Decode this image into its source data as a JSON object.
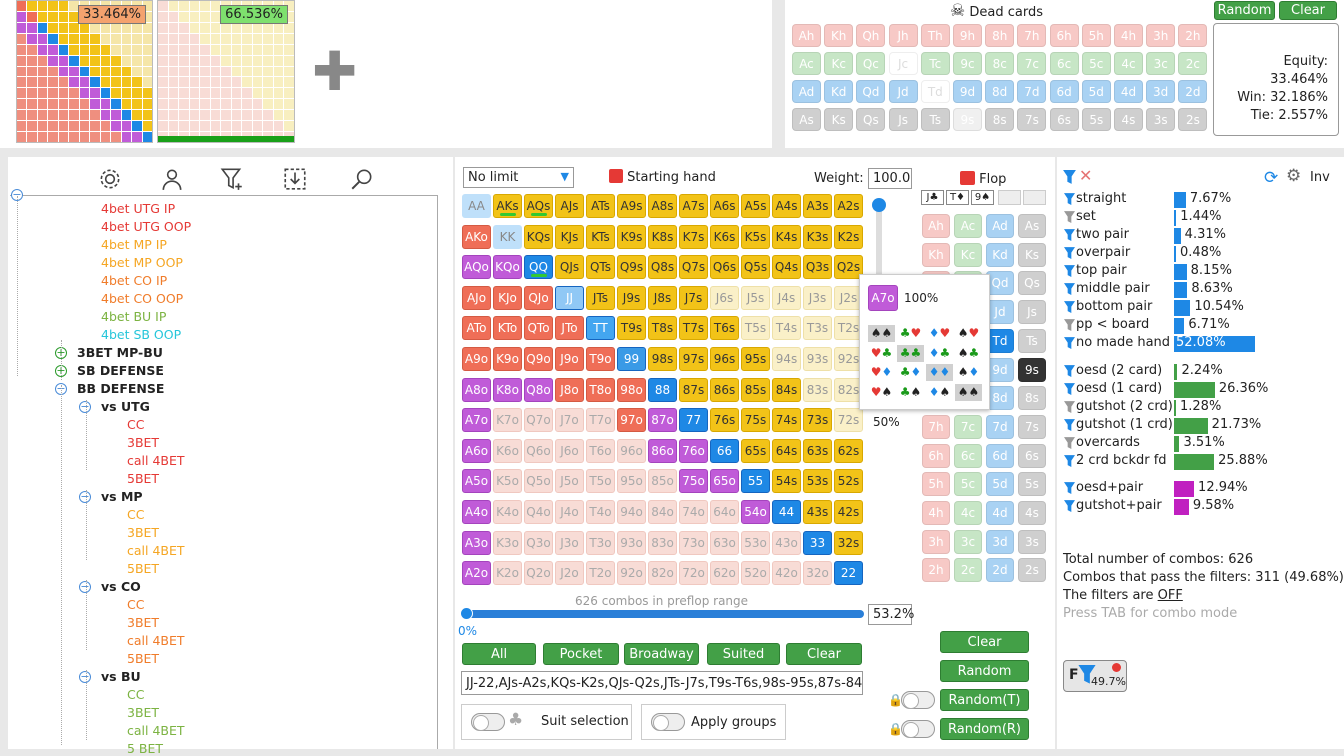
{
  "thumbs": {
    "left_equity": "33.464%",
    "right_equity": "66.536%"
  },
  "dead_cards": {
    "title": "Dead cards",
    "random_label": "Random",
    "clear_label": "Clear",
    "rows": [
      [
        "Ah",
        "Kh",
        "Qh",
        "Jh",
        "Th",
        "9h",
        "8h",
        "7h",
        "6h",
        "5h",
        "4h",
        "3h",
        "2h"
      ],
      [
        "Ac",
        "Kc",
        "Qc",
        "Jc",
        "Tc",
        "9c",
        "8c",
        "7c",
        "6c",
        "5c",
        "4c",
        "3c",
        "2c"
      ],
      [
        "Ad",
        "Kd",
        "Qd",
        "Jd",
        "Td",
        "9d",
        "8d",
        "7d",
        "6d",
        "5d",
        "4d",
        "3d",
        "2d"
      ],
      [
        "As",
        "Ks",
        "Qs",
        "Js",
        "Ts",
        "9s",
        "8s",
        "7s",
        "6s",
        "5s",
        "4s",
        "3s",
        "2s"
      ]
    ],
    "equity": "Equity: 33.464%",
    "win": "Win: 32.186%",
    "tie": "Tie: 2.557%"
  },
  "tree": {
    "items": [
      {
        "label": "4bet UTG IP",
        "color": "#e53935"
      },
      {
        "label": "4bet UTG OOP",
        "color": "#e53935"
      },
      {
        "label": "4bet MP IP",
        "color": "#f5a623"
      },
      {
        "label": "4bet MP OOP",
        "color": "#f5a623"
      },
      {
        "label": "4bet CO IP",
        "color": "#f07c2a"
      },
      {
        "label": "4bet CO OOP",
        "color": "#f07c2a"
      },
      {
        "label": "4bet BU IP",
        "color": "#7cb342"
      },
      {
        "label": "4bet SB OOP",
        "color": "#26c6da"
      },
      {
        "label": "3BET MP-BU",
        "color": "#222"
      },
      {
        "label": "SB DEFENSE",
        "color": "#222"
      },
      {
        "label": "BB DEFENSE",
        "color": "#222"
      },
      {
        "label": "vs UTG",
        "color": "#222"
      },
      {
        "label": "CC",
        "color": "#e53935"
      },
      {
        "label": "3BET",
        "color": "#e53935"
      },
      {
        "label": "call 4BET",
        "color": "#e53935"
      },
      {
        "label": "5BET",
        "color": "#e53935"
      },
      {
        "label": "vs MP",
        "color": "#222"
      },
      {
        "label": "CC",
        "color": "#f5a623"
      },
      {
        "label": "3BET",
        "color": "#f5a623"
      },
      {
        "label": "call 4BET",
        "color": "#f5a623"
      },
      {
        "label": "5BET",
        "color": "#f5a623"
      },
      {
        "label": "vs CO",
        "color": "#222"
      },
      {
        "label": "CC",
        "color": "#f07c2a"
      },
      {
        "label": "3BET",
        "color": "#f07c2a"
      },
      {
        "label": "call 4BET",
        "color": "#f07c2a"
      },
      {
        "label": "5BET",
        "color": "#f07c2a"
      },
      {
        "label": "vs BU",
        "color": "#222"
      },
      {
        "label": "CC",
        "color": "#7cb342"
      },
      {
        "label": "3BET",
        "color": "#7cb342"
      },
      {
        "label": "call 4BET",
        "color": "#7cb342"
      },
      {
        "label": "5 BET",
        "color": "#7cb342"
      }
    ]
  },
  "range": {
    "mode": "No limit",
    "starting_hand": "Starting hand",
    "weight_label": "Weight:",
    "weight_value": "100.00",
    "hands": [
      [
        "AA",
        "AKs",
        "AQs",
        "AJs",
        "ATs",
        "A9s",
        "A8s",
        "A7s",
        "A6s",
        "A5s",
        "A4s",
        "A3s",
        "A2s"
      ],
      [
        "AKo",
        "KK",
        "KQs",
        "KJs",
        "KTs",
        "K9s",
        "K8s",
        "K7s",
        "K6s",
        "K5s",
        "K4s",
        "K3s",
        "K2s"
      ],
      [
        "AQo",
        "KQo",
        "QQ",
        "QJs",
        "QTs",
        "Q9s",
        "Q8s",
        "Q7s",
        "Q6s",
        "Q5s",
        "Q4s",
        "Q3s",
        "Q2s"
      ],
      [
        "AJo",
        "KJo",
        "QJo",
        "JJ",
        "JTs",
        "J9s",
        "J8s",
        "J7s",
        "J6s",
        "J5s",
        "J4s",
        "J3s",
        "J2s"
      ],
      [
        "ATo",
        "KTo",
        "QTo",
        "JTo",
        "TT",
        "T9s",
        "T8s",
        "T7s",
        "T6s",
        "T5s",
        "T4s",
        "T3s",
        "T2s"
      ],
      [
        "A9o",
        "K9o",
        "Q9o",
        "J9o",
        "T9o",
        "99",
        "98s",
        "97s",
        "96s",
        "95s",
        "94s",
        "93s",
        "92s"
      ],
      [
        "A8o",
        "K8o",
        "Q8o",
        "J8o",
        "T8o",
        "98o",
        "88",
        "87s",
        "86s",
        "85s",
        "84s",
        "83s",
        "82s"
      ],
      [
        "A7o",
        "K7o",
        "Q7o",
        "J7o",
        "T7o",
        "97o",
        "87o",
        "77",
        "76s",
        "75s",
        "74s",
        "73s",
        "72s"
      ],
      [
        "A6o",
        "K6o",
        "Q6o",
        "J6o",
        "T6o",
        "96o",
        "86o",
        "76o",
        "66",
        "65s",
        "64s",
        "63s",
        "62s"
      ],
      [
        "A5o",
        "K5o",
        "Q5o",
        "J5o",
        "T5o",
        "95o",
        "85o",
        "75o",
        "65o",
        "55",
        "54s",
        "53s",
        "52s"
      ],
      [
        "A4o",
        "K4o",
        "Q4o",
        "J4o",
        "T4o",
        "94o",
        "84o",
        "74o",
        "64o",
        "54o",
        "44",
        "43s",
        "42s"
      ],
      [
        "A3o",
        "K3o",
        "Q3o",
        "J3o",
        "T3o",
        "93o",
        "83o",
        "73o",
        "63o",
        "53o",
        "43o",
        "33",
        "32s"
      ],
      [
        "A2o",
        "K2o",
        "Q2o",
        "J2o",
        "T2o",
        "92o",
        "82o",
        "72o",
        "62o",
        "52o",
        "42o",
        "32o",
        "22"
      ]
    ],
    "combos_text": "626 combos in preflop range",
    "slider_min": "0%",
    "pct_value": "53.2%",
    "buttons": [
      "All",
      "Pocket",
      "Broadway",
      "Suited",
      "Clear"
    ],
    "range_text": "JJ-22,AJs-A2s,KQs-K2s,QJs-Q2s,JTs-J7s,T9s-T6s,98s-95s,87s-84s,76",
    "suit_selection": "Suit selection",
    "apply_groups": "Apply groups",
    "popup_hand": "A7o",
    "popup_pct": "100%",
    "popup_pct2": "50%"
  },
  "flop": {
    "title": "Flop",
    "board": [
      "J♣",
      "T♦",
      "9♠"
    ],
    "rows": [
      [
        "Ah",
        "Ac",
        "Ad",
        "As"
      ],
      [
        "Kh",
        "Kc",
        "Kd",
        "Ks"
      ],
      [
        "Qh",
        "Qc",
        "Qd",
        "Qs"
      ],
      [
        "Jh",
        "Jc",
        "Jd",
        "Js"
      ],
      [
        "Th",
        "Tc",
        "Td",
        "Ts"
      ],
      [
        "9h",
        "9c",
        "9d",
        "9s"
      ],
      [
        "8h",
        "8c",
        "8d",
        "8s"
      ],
      [
        "7h",
        "7c",
        "7d",
        "7s"
      ],
      [
        "6h",
        "6c",
        "6d",
        "6s"
      ],
      [
        "5h",
        "5c",
        "5d",
        "5s"
      ],
      [
        "4h",
        "4c",
        "4d",
        "4s"
      ],
      [
        "3h",
        "3c",
        "3d",
        "3s"
      ],
      [
        "2h",
        "2c",
        "2d",
        "2s"
      ]
    ],
    "buttons": [
      "Clear",
      "Random",
      "Random(T)",
      "Random(R)"
    ]
  },
  "stats": {
    "inv_label": "Inv",
    "made": [
      {
        "label": "straight",
        "value": "7.67%",
        "pct": 7.67,
        "color": "#1e88e5"
      },
      {
        "label": "set",
        "value": "1.44%",
        "pct": 1.44,
        "color": "#1e88e5"
      },
      {
        "label": "two pair",
        "value": "4.31%",
        "pct": 4.31,
        "color": "#1e88e5"
      },
      {
        "label": "overpair",
        "value": "0.48%",
        "pct": 0.48,
        "color": "#1e88e5"
      },
      {
        "label": "top pair",
        "value": "8.15%",
        "pct": 8.15,
        "color": "#1e88e5"
      },
      {
        "label": "middle pair",
        "value": "8.63%",
        "pct": 8.63,
        "color": "#1e88e5"
      },
      {
        "label": "bottom pair",
        "value": "10.54%",
        "pct": 10.54,
        "color": "#1e88e5"
      },
      {
        "label": "pp < board",
        "value": "6.71%",
        "pct": 6.71,
        "color": "#1e88e5"
      },
      {
        "label": "no made hand",
        "value": "52.08%",
        "pct": 52.08,
        "color": "#1e88e5"
      }
    ],
    "draws": [
      {
        "label": "oesd (2 card)",
        "value": "2.24%",
        "pct": 2.24,
        "color": "#43a047"
      },
      {
        "label": "oesd (1 card)",
        "value": "26.36%",
        "pct": 26.36,
        "color": "#43a047"
      },
      {
        "label": "gutshot (2 crd)",
        "value": "1.28%",
        "pct": 1.28,
        "color": "#43a047"
      },
      {
        "label": "gutshot (1 crd)",
        "value": "21.73%",
        "pct": 21.73,
        "color": "#43a047"
      },
      {
        "label": "overcards",
        "value": "3.51%",
        "pct": 3.51,
        "color": "#43a047"
      },
      {
        "label": "2 crd bckdr fd",
        "value": "25.88%",
        "pct": 25.88,
        "color": "#43a047"
      }
    ],
    "combos": [
      {
        "label": "oesd+pair",
        "value": "12.94%",
        "pct": 12.94,
        "color": "#c020c0"
      },
      {
        "label": "gutshot+pair",
        "value": "9.58%",
        "pct": 9.58,
        "color": "#c020c0"
      }
    ],
    "total": "Total number of combos: 626",
    "pass": "Combos that pass the filters: 311 (49.68%)",
    "filters_prefix": "The filters are ",
    "filters_state": "OFF",
    "press_tab": "Press TAB for combo mode",
    "filter_pct": "49.7%"
  }
}
